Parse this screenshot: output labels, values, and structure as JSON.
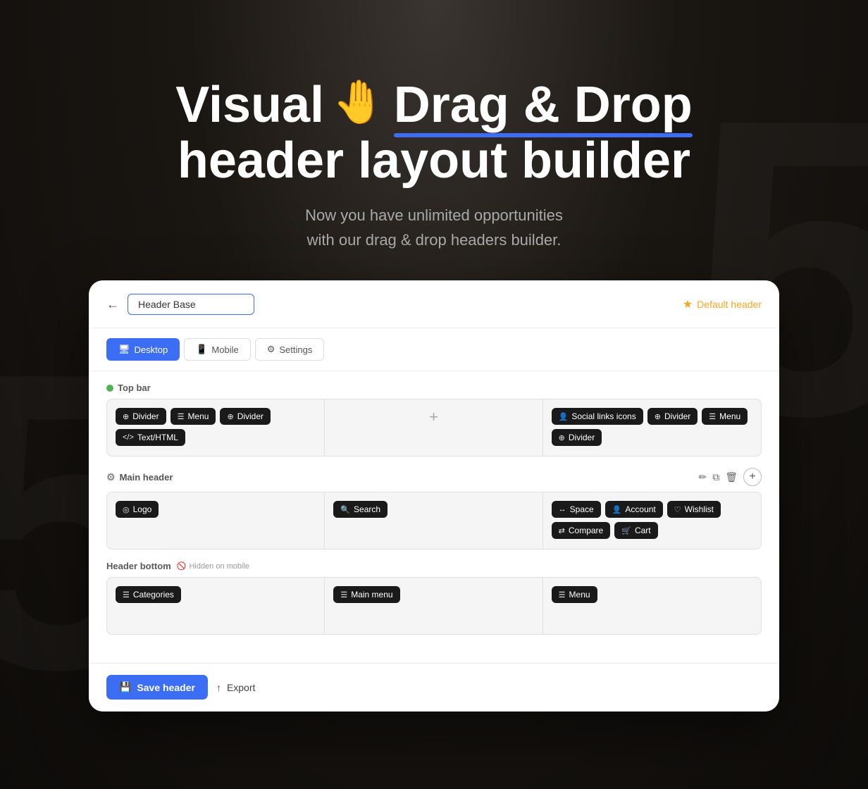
{
  "hero": {
    "line1_before": "Visual ",
    "line1_highlight": "Drag & Drop",
    "line2": "header layout builder",
    "subtitle_line1": "Now you have unlimited opportunities",
    "subtitle_line2": "with our drag & drop headers builder.",
    "hand_emoji": "🤚"
  },
  "card": {
    "back_arrow": "←",
    "input_value": "Header Base",
    "default_header_label": "Default header",
    "star": "★"
  },
  "tabs": [
    {
      "id": "desktop",
      "label": "Desktop",
      "icon": "🖥",
      "active": true
    },
    {
      "id": "mobile",
      "label": "Mobile",
      "icon": "📱",
      "active": false
    },
    {
      "id": "settings",
      "label": "Settings",
      "icon": "⚙",
      "active": false
    }
  ],
  "topbar": {
    "label": "Top bar",
    "left_chips": [
      {
        "icon": "⊕",
        "label": "Divider"
      },
      {
        "icon": "☰",
        "label": "Menu"
      },
      {
        "icon": "⊕",
        "label": "Divider"
      },
      {
        "icon": "⟨⟩",
        "label": "Text/HTML"
      }
    ],
    "right_chips": [
      {
        "icon": "👤",
        "label": "Social links icons"
      },
      {
        "icon": "⊕",
        "label": "Divider"
      },
      {
        "icon": "☰",
        "label": "Menu"
      },
      {
        "icon": "⊕",
        "label": "Divider"
      }
    ]
  },
  "mainheader": {
    "label": "Main header",
    "tooltip_icons": [
      "✏",
      "⧉",
      "🗑"
    ],
    "left_chips": [
      {
        "icon": "◎",
        "label": "Logo"
      }
    ],
    "center_chips": [
      {
        "icon": "🔍",
        "label": "Search"
      }
    ],
    "right_chips": [
      {
        "icon": "↔",
        "label": "Space"
      },
      {
        "icon": "👤",
        "label": "Account"
      },
      {
        "icon": "♡",
        "label": "Wishlist"
      },
      {
        "icon": "⇄",
        "label": "Compare"
      },
      {
        "icon": "🛒",
        "label": "Cart"
      }
    ]
  },
  "headerbottom": {
    "label": "Header bottom",
    "hidden_label": "Hidden on mobile",
    "left_chips": [
      {
        "icon": "☰",
        "label": "Categories"
      }
    ],
    "center_chips": [
      {
        "icon": "☰",
        "label": "Main menu"
      }
    ],
    "right_chips": [
      {
        "icon": "☰",
        "label": "Menu"
      }
    ]
  },
  "footer": {
    "save_label": "Save header",
    "save_icon": "💾",
    "export_label": "Export",
    "export_icon": "↑"
  }
}
